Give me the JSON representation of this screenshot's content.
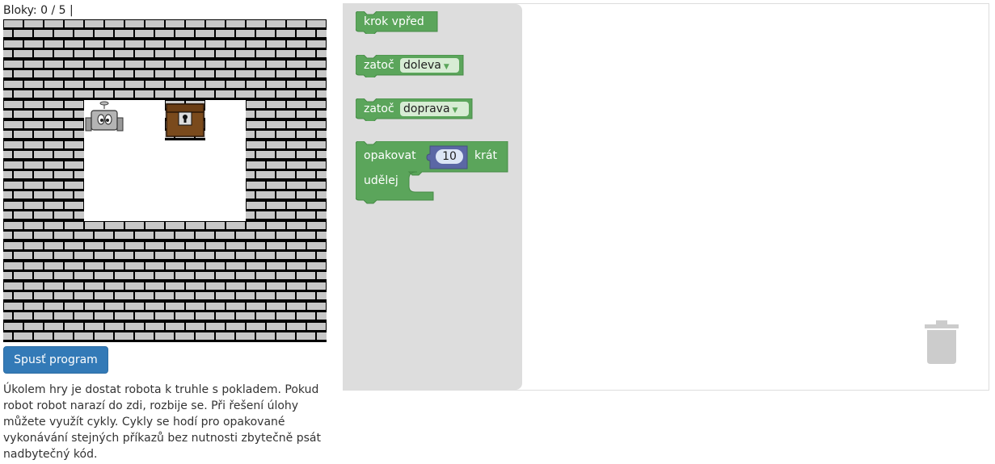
{
  "status": {
    "blocks_label": "Bloky: 0 / 5 |"
  },
  "maze": {
    "size": [
      8,
      8
    ],
    "open_cells": [
      [
        2,
        2
      ],
      [
        2,
        3
      ],
      [
        2,
        4
      ],
      [
        3,
        2
      ],
      [
        3,
        3
      ],
      [
        3,
        4
      ],
      [
        4,
        3
      ],
      [
        4,
        4
      ],
      [
        5,
        2
      ],
      [
        5,
        3
      ],
      [
        5,
        4
      ]
    ],
    "robot_cell": [
      2,
      2
    ],
    "chest_cell": [
      4,
      2
    ],
    "colors": {
      "brick": "#c8c8c8",
      "mortar": "#000000",
      "floor": "#ffffff",
      "chest": "#7a4a1c"
    }
  },
  "run_button": {
    "label": "Spusť program"
  },
  "description": "Úkolem hry je dostat robota k truhle s pokladem. Pokud robot robot narazí do zdi, rozbije se. Při řešení úlohy můžete využít cykly. Cykly se hodí pro opakované vykonávání stejných příkazů bez nutnosti zbytečně psát nadbytečný kód.",
  "toolbox": {
    "move_forward": "krok vpřed",
    "turn_left": {
      "label": "zatoč",
      "option": "doleva"
    },
    "turn_right": {
      "label": "zatoč",
      "option": "doprava"
    },
    "repeat": {
      "label": "opakovat",
      "count": "10",
      "times": "krát",
      "do": "udělej"
    }
  },
  "colors": {
    "block_green": "#5ba55b",
    "block_green_dark": "#468a46",
    "number_block": "#5b67a5",
    "button_blue": "#337ab7",
    "flyout_bg": "#dddddd",
    "trash": "#cccccc"
  },
  "icons": [
    "robot-icon",
    "treasure-chest-icon",
    "trash-icon",
    "dropdown-arrow-icon"
  ]
}
